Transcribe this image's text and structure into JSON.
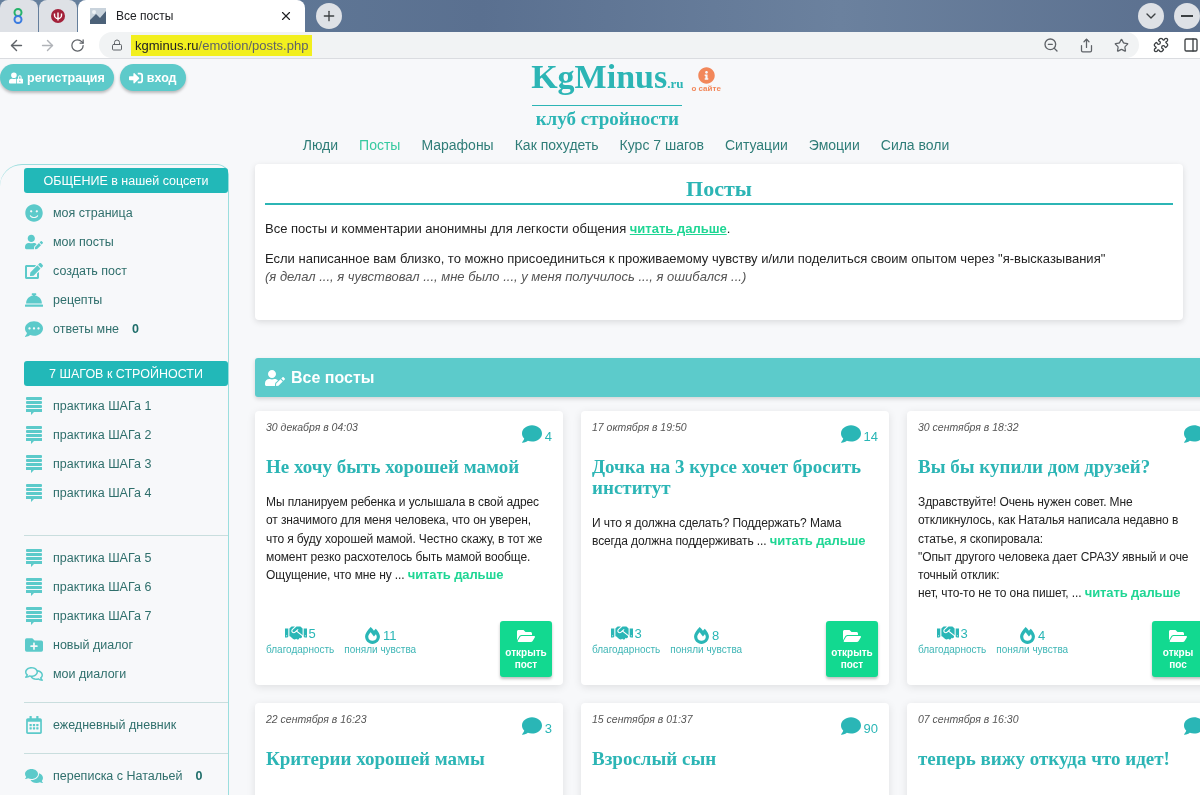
{
  "browser": {
    "tabs": [
      {
        "kind": "pinned",
        "selected": false
      },
      {
        "kind": "pinned",
        "selected": false
      },
      {
        "kind": "page",
        "title": "Все посты",
        "selected": true
      }
    ],
    "url_host": "kgminus.ru",
    "url_path": "/emotion/posts.php"
  },
  "header": {
    "buttons": [
      {
        "kind": "register",
        "label": "регистрация"
      },
      {
        "kind": "login",
        "label": "вход"
      }
    ],
    "logo": {
      "name": "KgMinus",
      "suffix": ".ru",
      "tagline": "клуб стройности"
    },
    "about": "о сайте"
  },
  "nav": [
    {
      "label": "Люди",
      "selected": false
    },
    {
      "label": "Посты",
      "selected": true
    },
    {
      "label": "Марафоны",
      "selected": false
    },
    {
      "label": "Как похудеть",
      "selected": false
    },
    {
      "label": "Курс 7 шагов",
      "selected": false
    },
    {
      "label": "Ситуации",
      "selected": false
    },
    {
      "label": "Эмоции",
      "selected": false
    },
    {
      "label": "Сила воли",
      "selected": false
    }
  ],
  "sidebar": {
    "groups": [
      {
        "heading": "ОБЩЕНИЕ в нашей соцсети",
        "items": [
          {
            "kind": "smile",
            "label": "моя страница"
          },
          {
            "kind": "user-edit",
            "label": "мои посты"
          },
          {
            "kind": "edit",
            "label": "создать пост"
          },
          {
            "kind": "bell",
            "label": "рецепты"
          },
          {
            "kind": "comment-dots",
            "label": "ответы мне",
            "count": "0"
          }
        ]
      },
      {
        "heading": "7 ШАГОВ к СТРОЙНОСТИ",
        "items": [
          {
            "kind": "list",
            "label": "практика ШАГа 1"
          },
          {
            "kind": "list",
            "label": "практика ШАГа 2"
          },
          {
            "kind": "list",
            "label": "практика ШАГа 3"
          },
          {
            "kind": "list",
            "label": "практика ШАГа 4"
          }
        ]
      },
      {
        "items": [
          {
            "kind": "list",
            "label": "практика ШАГа 5"
          },
          {
            "kind": "list",
            "label": "практика ШАГа 6"
          },
          {
            "kind": "list",
            "label": "практика ШАГа 7"
          },
          {
            "kind": "folder-plus",
            "label": "новый диалог"
          },
          {
            "kind": "comments-outline",
            "label": "мои диалоги"
          }
        ]
      },
      {
        "items": [
          {
            "kind": "calendar",
            "label": "ежедневный дневник"
          }
        ]
      },
      {
        "items": [
          {
            "kind": "comments",
            "label": "переписка с Натальей",
            "count": "0"
          }
        ]
      }
    ]
  },
  "intro": {
    "title": "Посты",
    "text": "Все посты и комментарии анонимны для легкости общения",
    "link": "читать дальше",
    "text_end": ".",
    "paragraph": "Если написанное вам близко, то можно присоединиться к проживаемому чувству и/или поделиться своим опытом через \"я-высказывания\"",
    "note": "(я делал ..., я чувствовал ..., мне было ..., у меня получилось ..., я ошибался ...)"
  },
  "section": {
    "title": "Все посты"
  },
  "posts": [
    {
      "date": "30 декабря в 04:03",
      "comments": "4",
      "title": "Не хочу быть хорошей мамой",
      "body": "Мы планируем ребенка и услышала в свой адрес\nот значимого для меня человека, что он уверен,\nчто я буду хорошей мамой. Честно скажу, в тот же\nмомент резко расхотелось быть мамой вообще.\nОщущение, что мне ну ...",
      "more": "читать дальше",
      "thanks": "5",
      "thanks_label": "благодарность",
      "feelings": "11",
      "feelings_label": "поняли чувства",
      "open_lines": [
        "открыть",
        "пост"
      ]
    },
    {
      "date": "17 октября в 19:50",
      "comments": "14",
      "title": "Дочка на 3 курсе хочет бросить институт",
      "body": "И что я должна сделать? Поддержать? Мама\nвсегда должна поддерживать ...",
      "more": "читать дальше",
      "thanks": "3",
      "thanks_label": "благодарность",
      "feelings": "8",
      "feelings_label": "поняли чувства",
      "open_lines": [
        "открыть",
        "пост"
      ]
    },
    {
      "date": "30 сентября в 18:32",
      "title": "Вы бы купили дом друзей?",
      "body": "Здравствуйте! Очень нужен совет. Мне\nоткликнулось, как Наталья написала недавно в\nстатье, я скопировала:\n\"Опыт другого человека дает СРАЗУ явный и оче\nточный отклик:\nнет, что-то не то она пишет, ...",
      "more": "читать дальше",
      "thanks": "3",
      "thanks_label": "благодарность",
      "feelings": "4",
      "feelings_label": "поняли чувства",
      "open_lines": [
        "откры",
        "пос"
      ]
    },
    {
      "date": "22 сентября в 16:23",
      "comments": "3",
      "title": "Критерии хорошей мамы"
    },
    {
      "date": "15 сентября в 01:37",
      "comments": "90",
      "title": "Взрослый сын"
    },
    {
      "date": "07 сентября в 16:30",
      "title": "теперь вижу откуда что идет!"
    }
  ]
}
